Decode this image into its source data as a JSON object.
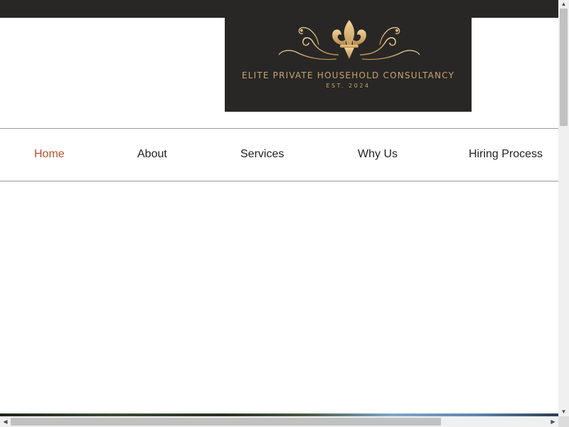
{
  "brand": {
    "name": "ELITE PRIVATE HOUSEHOLD CONSULTANCY",
    "established": "EST. 2024",
    "logo_icon": "fleur-de-lis-icon",
    "logo_color": "#c8a46a",
    "background": "#282726"
  },
  "nav": {
    "active_color": "#b8502a",
    "items": [
      {
        "label": "Home"
      },
      {
        "label": "About"
      },
      {
        "label": "Services"
      },
      {
        "label": "Why Us"
      },
      {
        "label": "Hiring Process"
      }
    ]
  },
  "scrollbars": {
    "up_icon": "▲",
    "down_icon": "▼",
    "left_icon": "◀",
    "right_icon": "▶"
  }
}
